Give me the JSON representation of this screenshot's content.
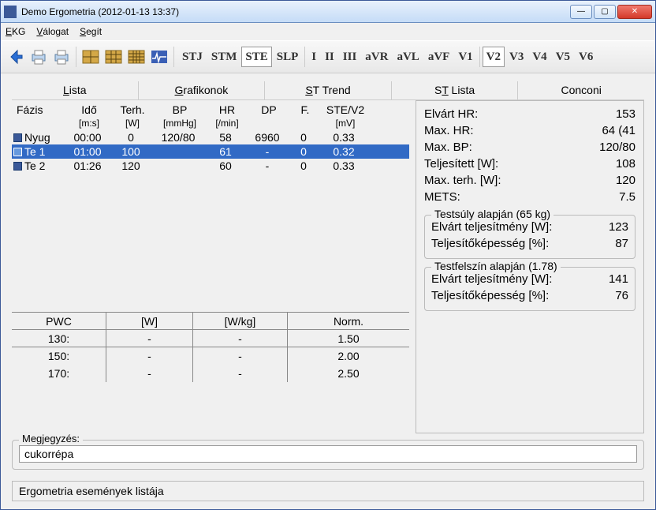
{
  "window": {
    "title": "Demo Ergometria (2012-01-13 13:37)"
  },
  "menu": {
    "ekg": "EKG",
    "valogat": "Válogat",
    "segit": "Segít"
  },
  "leads": [
    "STJ",
    "STM",
    "STE",
    "SLP",
    "I",
    "II",
    "III",
    "aVR",
    "aVL",
    "aVF",
    "V1",
    "V2",
    "V3",
    "V4",
    "V5",
    "V6"
  ],
  "tabs": {
    "lista": "Lista",
    "grafikonok": "Grafikonok",
    "sttrend": "ST Trend",
    "stlista": "ST Lista",
    "conconi": "Conconi"
  },
  "phase_headers": {
    "fazis": "Fázis",
    "ido": "Idő",
    "ido_sub": "[m:s]",
    "terh": "Terh.",
    "terh_sub": "[W]",
    "bp": "BP",
    "bp_sub": "[mmHg]",
    "hr": "HR",
    "hr_sub": "[/min]",
    "dp": "DP",
    "f": "F.",
    "ste": "STE/V2",
    "ste_sub": "[mV]"
  },
  "phases": [
    {
      "name": "Nyug",
      "ido": "00:00",
      "terh": "0",
      "bp": "120/80",
      "hr": "58",
      "dp": "6960",
      "f": "0",
      "ste": "0.33",
      "sel": false
    },
    {
      "name": "Te 1",
      "ido": "01:00",
      "terh": "100",
      "bp": "",
      "hr": "61",
      "dp": "-",
      "f": "0",
      "ste": "0.32",
      "sel": true
    },
    {
      "name": "Te 2",
      "ido": "01:26",
      "terh": "120",
      "bp": "",
      "hr": "60",
      "dp": "-",
      "f": "0",
      "ste": "0.33",
      "sel": false
    }
  ],
  "pwc": {
    "headers": {
      "c1": "PWC",
      "c2": "[W]",
      "c3": "[W/kg]",
      "c4": "Norm."
    },
    "rows": [
      {
        "c1": "130:",
        "c2": "-",
        "c3": "-",
        "c4": "1.50"
      },
      {
        "c1": "150:",
        "c2": "-",
        "c3": "-",
        "c4": "2.00"
      },
      {
        "c1": "170:",
        "c2": "-",
        "c3": "-",
        "c4": "2.50"
      }
    ]
  },
  "stats": {
    "elvart_hr_l": "Elvárt HR:",
    "elvart_hr_v": "153",
    "max_hr_l": "Max. HR:",
    "max_hr_v": "64 (41",
    "max_bp_l": "Max. BP:",
    "max_bp_v": "120/80",
    "telj_w_l": "Teljesített [W]:",
    "telj_w_v": "108",
    "max_terh_l": "Max. terh. [W]:",
    "max_terh_v": "120",
    "mets_l": "METS:",
    "mets_v": "7.5"
  },
  "group1": {
    "legend": "Testsúly alapján  (65 kg)",
    "l1": "Elvárt teljesítmény [W]:",
    "v1": "123",
    "l2": "Teljesítőképesség [%]:",
    "v2": "87"
  },
  "group2": {
    "legend": "Testfelszín alapján   (1.78)",
    "l1": "Elvárt teljesítmény [W]:",
    "v1": "141",
    "l2": "Teljesítőképesség [%]:",
    "v2": "76"
  },
  "comment": {
    "label": "Megjegyzés:",
    "value": "cukorrépa"
  },
  "status": "Ergometria események listája"
}
